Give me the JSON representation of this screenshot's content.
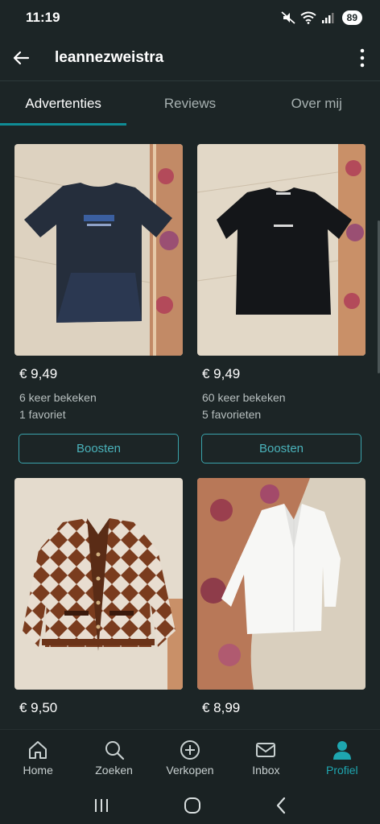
{
  "status": {
    "time": "11:19",
    "battery": "89"
  },
  "header": {
    "title": "leannezweistra"
  },
  "tabs": [
    {
      "label": "Advertenties",
      "active": true
    },
    {
      "label": "Reviews",
      "active": false
    },
    {
      "label": "Over mij",
      "active": false
    }
  ],
  "listings": [
    {
      "price": "€ 9,49",
      "views": "6 keer bekeken",
      "favorites": "1 favoriet",
      "boost_label": "Boosten",
      "image": "dark-navy-tshirt"
    },
    {
      "price": "€ 9,49",
      "views": "60 keer bekeken",
      "favorites": "5 favorieten",
      "boost_label": "Boosten",
      "image": "black-daily-paper-tshirt"
    },
    {
      "price": "€ 9,50",
      "image": "brown-argyle-cardigan"
    },
    {
      "price": "€ 8,99",
      "image": "white-blouse"
    }
  ],
  "bottom_nav": [
    {
      "label": "Home",
      "icon": "home-icon",
      "active": false
    },
    {
      "label": "Zoeken",
      "icon": "search-icon",
      "active": false
    },
    {
      "label": "Verkopen",
      "icon": "plus-circle-icon",
      "active": false
    },
    {
      "label": "Inbox",
      "icon": "mail-icon",
      "active": false
    },
    {
      "label": "Profiel",
      "icon": "profile-icon",
      "active": true
    }
  ],
  "colors": {
    "accent": "#1ea6b0",
    "background": "#1c2526",
    "boost_border": "#3aa3ab"
  }
}
